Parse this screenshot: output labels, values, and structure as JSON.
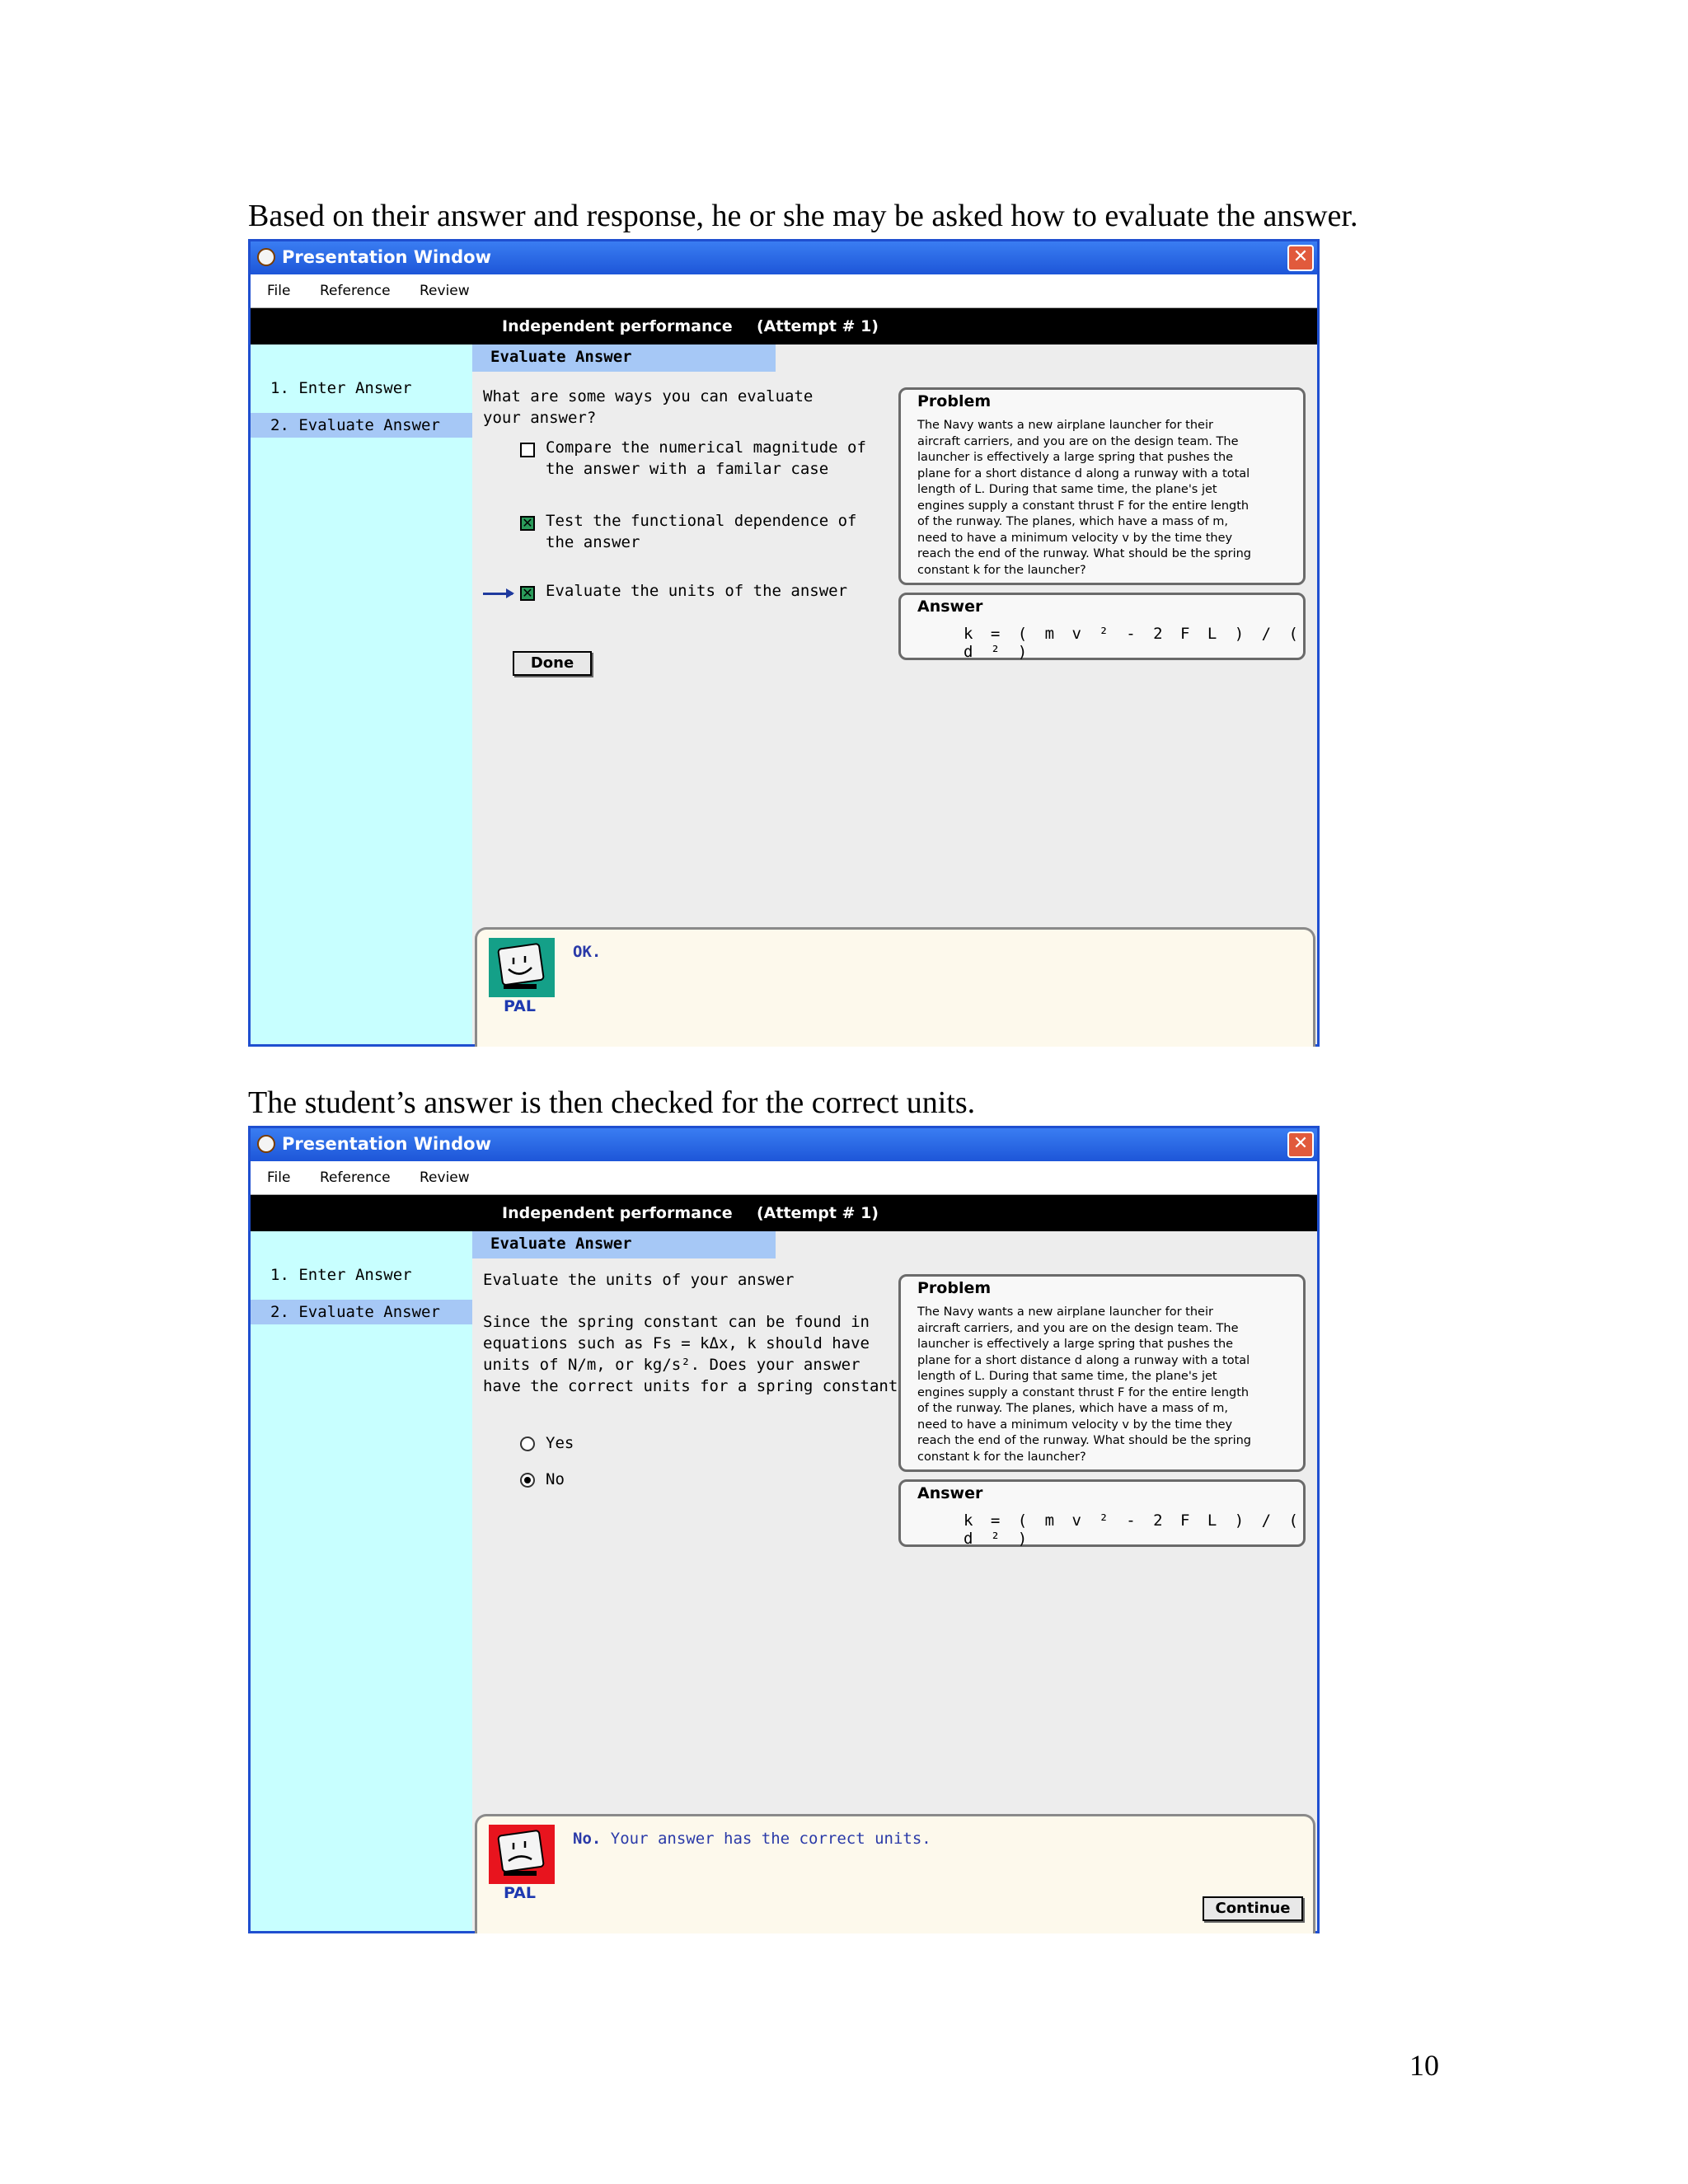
{
  "captions": {
    "first": "Based on their answer and response, he or she may be asked how to evaluate the answer.",
    "second": "The student’s answer is then checked for the correct units."
  },
  "page_number": "10",
  "window": {
    "title": "Presentation Window",
    "menu": [
      "File",
      "Reference",
      "Review"
    ],
    "header_title": "Independent performance",
    "attempt": "(Attempt # 1)",
    "section": "Evaluate Answer",
    "sidebar": [
      "1. Enter Answer",
      "2. Evaluate Answer"
    ]
  },
  "problem": {
    "title": "Problem",
    "lines": [
      "The Navy wants a new airplane launcher for their",
      "aircraft carriers, and you are on the design team.  The",
      "launcher is effectively a large spring that pushes the",
      "plane for a short distance d along a runway with a total",
      "length of L.  During that same time, the plane's jet",
      "engines supply a constant thrust F for the entire length",
      "of the runway.  The planes, which have a mass of m,",
      "need to have a minimum velocity v by the time they",
      "reach the end of the runway.  What should be the spring",
      "constant k for the launcher?"
    ]
  },
  "answer": {
    "title": "Answer",
    "formula": "k = ( m v ² - 2 F L ) / ( d ² )"
  },
  "screen1": {
    "prompt_lines": [
      "What are some ways you can evaluate",
      "your answer?"
    ],
    "options": [
      {
        "lines": [
          "Compare the numerical magnitude of",
          "the answer with a familar case"
        ],
        "checked": false
      },
      {
        "lines": [
          "Test the functional dependence of",
          "the answer"
        ],
        "checked": true
      },
      {
        "lines": [
          "Evaluate the units of the answer"
        ],
        "checked": true
      }
    ],
    "done_label": "Done",
    "pal_label": "PAL",
    "feedback": "OK."
  },
  "screen2": {
    "prompt_title": "Evaluate the units of your answer",
    "prompt_lines": [
      "Since the spring constant can be found in",
      "equations such as Fs = kΔx, k should have",
      "units of N/m, or kg/s². Does your answer",
      "have the correct units for a spring constant?"
    ],
    "radio_options": [
      "Yes",
      "No"
    ],
    "selected": "No",
    "pal_label": "PAL",
    "feedback_strong": "No.",
    "feedback_rest": "Your answer has the correct units.",
    "continue_label": "Continue"
  },
  "colors": {
    "sidebar_bg": "#c8ffff",
    "section_tab": "#a6c8f6",
    "titlebar": "#1d56d8",
    "feedback_text": "#2a3aa8",
    "pal_happy": "#14a088",
    "pal_sad": "#e8141e"
  }
}
